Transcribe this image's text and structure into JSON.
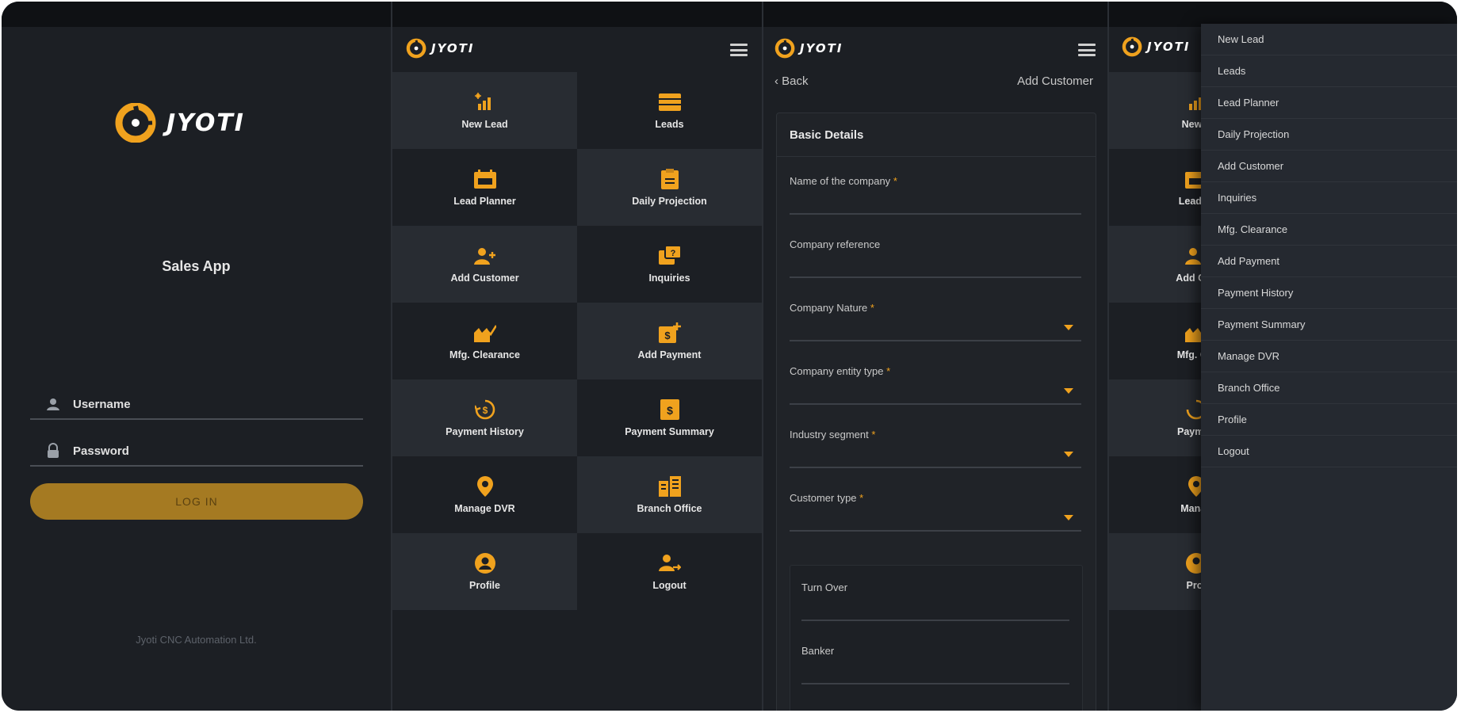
{
  "brand": {
    "name": "JYOTI",
    "accent": "#f0a21e",
    "button_color": "#a57a22"
  },
  "login": {
    "app_title": "Sales App",
    "username_placeholder": "Username",
    "password_placeholder": "Password",
    "login_button": "LOG IN",
    "footer": "Jyoti CNC Automation Ltd."
  },
  "dashboard": {
    "tiles": [
      {
        "label": "New Lead",
        "icon": "new-lead-icon"
      },
      {
        "label": "Leads",
        "icon": "leads-icon"
      },
      {
        "label": "Lead Planner",
        "icon": "lead-planner-icon"
      },
      {
        "label": "Daily Projection",
        "icon": "daily-projection-icon"
      },
      {
        "label": "Add Customer",
        "icon": "add-customer-icon"
      },
      {
        "label": "Inquiries",
        "icon": "inquiries-icon"
      },
      {
        "label": "Mfg. Clearance",
        "icon": "mfg-clearance-icon"
      },
      {
        "label": "Add Payment",
        "icon": "add-payment-icon"
      },
      {
        "label": "Payment History",
        "icon": "payment-history-icon"
      },
      {
        "label": "Payment Summary",
        "icon": "payment-summary-icon"
      },
      {
        "label": "Manage DVR",
        "icon": "location-pin-icon"
      },
      {
        "label": "Branch Office",
        "icon": "branch-office-icon"
      },
      {
        "label": "Profile",
        "icon": "profile-icon"
      },
      {
        "label": "Logout",
        "icon": "logout-icon"
      }
    ]
  },
  "add_customer": {
    "back_label": "Back",
    "title": "Add Customer",
    "section_title": "Basic Details",
    "required_mark": "*",
    "fields": [
      {
        "label": "Name of the company",
        "required": true,
        "dropdown": false
      },
      {
        "label": "Company reference",
        "required": false,
        "dropdown": false
      },
      {
        "label": "Company Nature",
        "required": true,
        "dropdown": true
      },
      {
        "label": "Company entity type",
        "required": true,
        "dropdown": true
      },
      {
        "label": "Industry segment",
        "required": true,
        "dropdown": true
      },
      {
        "label": "Customer type",
        "required": true,
        "dropdown": true
      }
    ],
    "sub_fields": [
      {
        "label": "Turn Over"
      },
      {
        "label": "Banker"
      }
    ]
  },
  "drawer": {
    "items": [
      "New Lead",
      "Leads",
      "Lead Planner",
      "Daily Projection",
      "Add Customer",
      "Inquiries",
      "Mfg. Clearance",
      "Add Payment",
      "Payment History",
      "Payment Summary",
      "Manage DVR",
      "Branch Office",
      "Profile",
      "Logout"
    ],
    "background_partial_labels": [
      "New L",
      "Lead Pl",
      "Add Cus",
      "Mfg. Cle",
      "Paymen",
      "Manag",
      "Prof"
    ]
  }
}
